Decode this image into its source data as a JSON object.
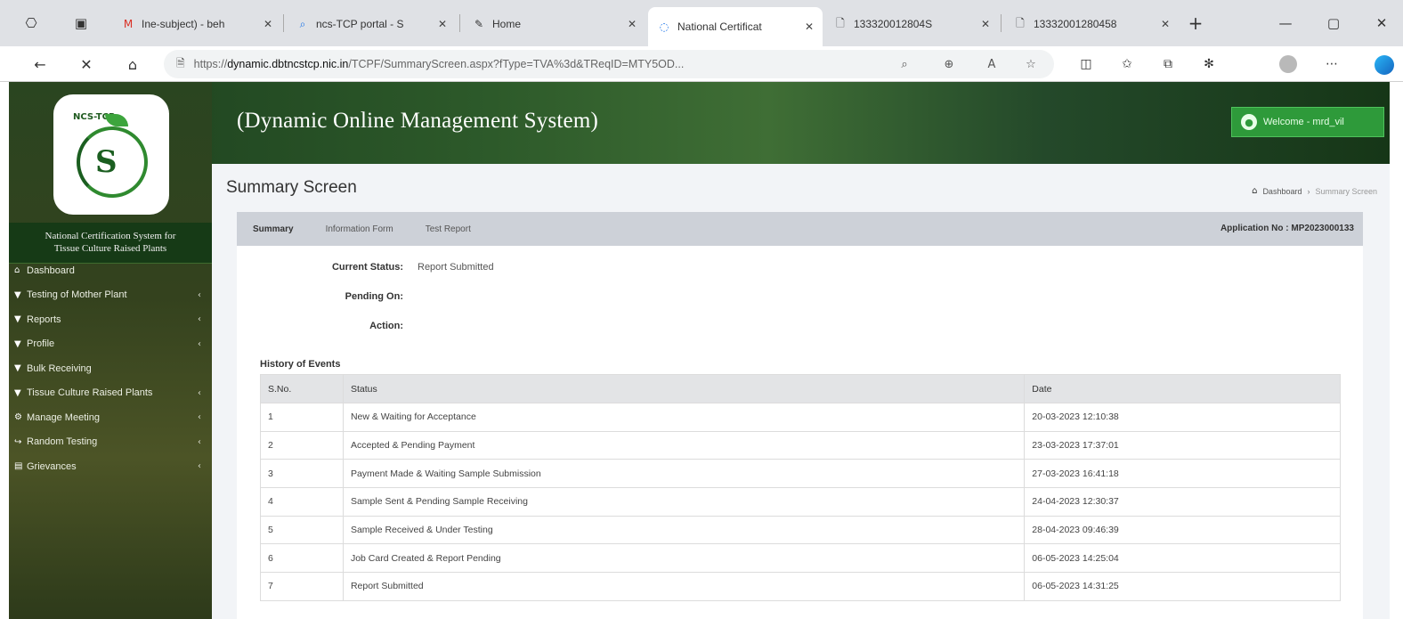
{
  "browser": {
    "tabs": [
      {
        "title": "Ine-subject) - beh",
        "icon": "gmail-icon"
      },
      {
        "title": "ncs-TCP portal - S",
        "icon": "search-icon"
      },
      {
        "title": "Home",
        "icon": "edit-icon"
      },
      {
        "title": "National Certificat",
        "icon": "loading-icon"
      },
      {
        "title": "133320012804S",
        "icon": "document-icon"
      },
      {
        "title": "13332001280458",
        "icon": "document-icon"
      }
    ],
    "url_prefix": "https://",
    "url_host": "dynamic.dbtncstcp.nic.in",
    "url_path": "/TCPF/SummaryScreen.aspx?fType=TVA%3d&TReqID=MTY5OD..."
  },
  "app": {
    "title": "(Dynamic Online Management System)",
    "welcome": "Welcome - mrd_vil",
    "logo_text": "NCS-TCP",
    "brand_line1": "National Certification System for",
    "brand_line2": "Tissue Culture Raised Plants"
  },
  "sidebar": {
    "items": [
      {
        "label": "Dashboard",
        "icon": "home-icon",
        "arrow": false
      },
      {
        "label": "Testing of Mother Plant",
        "icon": "filter-icon",
        "arrow": true
      },
      {
        "label": "Reports",
        "icon": "filter-icon",
        "arrow": true
      },
      {
        "label": "Profile",
        "icon": "filter-icon",
        "arrow": true
      },
      {
        "label": "Bulk Receiving",
        "icon": "filter-icon",
        "arrow": false
      },
      {
        "label": "Tissue Culture Raised Plants",
        "icon": "filter-icon",
        "arrow": true
      },
      {
        "label": "Manage Meeting",
        "icon": "gear-icon",
        "arrow": true
      },
      {
        "label": "Random Testing",
        "icon": "share-icon",
        "arrow": true
      },
      {
        "label": "Grievances",
        "icon": "file-icon",
        "arrow": true
      }
    ]
  },
  "page": {
    "title": "Summary Screen",
    "breadcrumb": {
      "home": "Dashboard",
      "current": "Summary Screen"
    },
    "tabs": [
      "Summary",
      "Information Form",
      "Test Report"
    ],
    "application_no": "Application No : MP2023000133"
  },
  "status": {
    "current_label": "Current Status:",
    "current_value": "Report Submitted",
    "pending_label": "Pending On:",
    "pending_value": "",
    "action_label": "Action:",
    "action_value": ""
  },
  "history": {
    "title": "History of Events",
    "headers": [
      "S.No.",
      "Status",
      "Date"
    ],
    "rows": [
      {
        "sno": "1",
        "status": "New & Waiting for Acceptance",
        "date": "20-03-2023 12:10:38"
      },
      {
        "sno": "2",
        "status": "Accepted & Pending Payment",
        "date": "23-03-2023 17:37:01"
      },
      {
        "sno": "3",
        "status": "Payment Made & Waiting Sample Submission",
        "date": "27-03-2023 16:41:18"
      },
      {
        "sno": "4",
        "status": "Sample Sent & Pending Sample Receiving",
        "date": "24-04-2023 12:30:37"
      },
      {
        "sno": "5",
        "status": "Sample Received & Under Testing",
        "date": "28-04-2023 09:46:39"
      },
      {
        "sno": "6",
        "status": "Job Card Created & Report Pending",
        "date": "06-05-2023 14:25:04"
      },
      {
        "sno": "7",
        "status": "Report Submitted",
        "date": "06-05-2023 14:31:25"
      }
    ]
  }
}
